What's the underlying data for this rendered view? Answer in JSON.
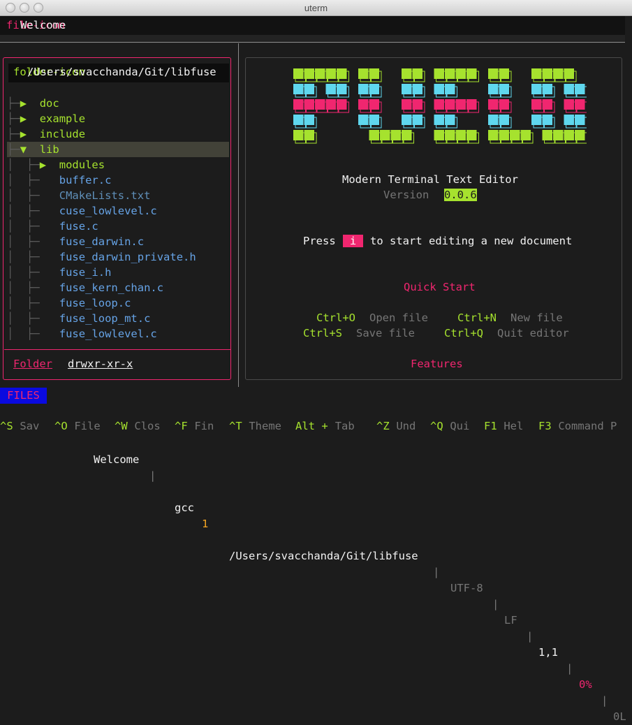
{
  "window": {
    "title": "uterm"
  },
  "tabbar": {
    "icon": "file-icon",
    "label": "Welcome"
  },
  "explorer": {
    "path_icon": "folder-icon",
    "path": "/Users/svacchanda/Git/libfuse",
    "items": [
      {
        "prefix": "├─▶ ",
        "icon": "",
        "name": "doc",
        "kind": "dir"
      },
      {
        "prefix": "├─▶ ",
        "icon": "",
        "name": "example",
        "kind": "dir"
      },
      {
        "prefix": "├─▶ ",
        "icon": "",
        "name": "include",
        "kind": "dir"
      },
      {
        "prefix": "├─▼ ",
        "icon": "",
        "name": "lib",
        "kind": "dir-open"
      },
      {
        "prefix": "│  ├─▶ ",
        "icon": "",
        "name": "modules",
        "kind": "dir"
      },
      {
        "prefix": "│  ├─  ",
        "icon": "",
        "name": "buffer.c",
        "kind": "file"
      },
      {
        "prefix": "│  ├─  ",
        "icon": "",
        "name": "CMakeLists.txt",
        "kind": "file-dim"
      },
      {
        "prefix": "│  ├─  ",
        "icon": "",
        "name": "cuse_lowlevel.c",
        "kind": "file"
      },
      {
        "prefix": "│  ├─  ",
        "icon": "",
        "name": "fuse.c",
        "kind": "file"
      },
      {
        "prefix": "│  ├─  ",
        "icon": "",
        "name": "fuse_darwin.c",
        "kind": "file"
      },
      {
        "prefix": "│  ├─  ",
        "icon": "",
        "name": "fuse_darwin_private.h",
        "kind": "file"
      },
      {
        "prefix": "│  ├─  ",
        "icon": "",
        "name": "fuse_i.h",
        "kind": "file"
      },
      {
        "prefix": "│  ├─  ",
        "icon": "",
        "name": "fuse_kern_chan.c",
        "kind": "file"
      },
      {
        "prefix": "│  ├─  ",
        "icon": "",
        "name": "fuse_loop.c",
        "kind": "file"
      },
      {
        "prefix": "│  ├─  ",
        "icon": "",
        "name": "fuse_loop_mt.c",
        "kind": "file"
      },
      {
        "prefix": "│  ├─  ",
        "icon": "",
        "name": "fuse_lowlevel.c",
        "kind": "file"
      }
    ],
    "footer_kind": "Folder",
    "footer_perms": "drwxr-xr-x"
  },
  "welcome": {
    "subtitle": "Modern Terminal Text Editor",
    "version_label": "Version",
    "version": "0.0.6",
    "press_icon": "",
    "press": "Press",
    "key": "i",
    "press_rest": "to start editing a new document",
    "quickstart_icon": "",
    "quickstart": "Quick Start",
    "shortcuts": [
      {
        "key": "Ctrl+O",
        "label": "Open file"
      },
      {
        "key": "Ctrl+N",
        "label": "New file"
      },
      {
        "key": "Ctrl+S",
        "label": "Save file"
      },
      {
        "key": "Ctrl+Q",
        "label": "Quit editor"
      }
    ],
    "features_icon": "",
    "features": "Features"
  },
  "status": {
    "mode": "FILES",
    "icon1": "",
    "icon2": "",
    "doc": "Welcome",
    "sep": "|",
    "compiler_icon": "",
    "compiler": "gcc",
    "compiler_count": "1",
    "path_icon": "",
    "path": "/Users/svacchanda/Git/libfuse",
    "encoding": "UTF-8",
    "eol": "LF",
    "pos": "1,1",
    "percent": "0%",
    "lines": "0L"
  },
  "keys": [
    {
      "k": "^S",
      "l": "Sav"
    },
    {
      "k": "^O",
      "l": "File"
    },
    {
      "k": "^W",
      "l": "Clos"
    },
    {
      "k": "^F",
      "l": "Fin"
    },
    {
      "k": "^T",
      "l": "Theme"
    },
    {
      "k": "Alt +",
      "l": "Tab"
    },
    {
      "k": "^Z",
      "l": "Und"
    },
    {
      "k": "^Q",
      "l": "Qui"
    },
    {
      "k": "F1",
      "l": "Hel"
    },
    {
      "k": "F3",
      "l": "Command P"
    }
  ],
  "colors": {
    "accent": "#f0266f",
    "green": "#a6e22e",
    "blue": "#66a3e6",
    "cyan": "#5fd7ee",
    "status_blue": "#0a0ae0"
  }
}
